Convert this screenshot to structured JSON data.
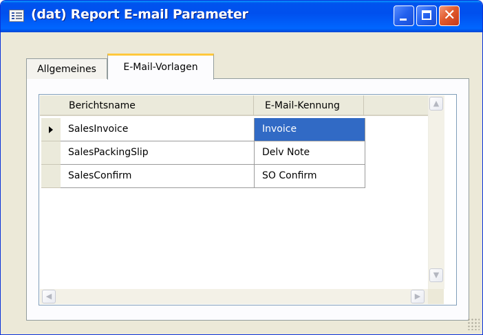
{
  "window": {
    "title": "(dat) Report E-mail Parameter"
  },
  "tabs": [
    {
      "label": "Allgemeines"
    },
    {
      "label": "E-Mail-Vorlagen"
    }
  ],
  "grid": {
    "columns": [
      "Berichtsname",
      "E-Mail-Kennung"
    ],
    "rows": [
      {
        "name": "SalesInvoice",
        "code": "Invoice"
      },
      {
        "name": "SalesPackingSlip",
        "code": "Delv Note"
      },
      {
        "name": "SalesConfirm",
        "code": "SO Confirm"
      }
    ]
  },
  "glyphs": {
    "close": "✕",
    "up": "▲",
    "down": "▼",
    "left": "◀",
    "right": "▶"
  },
  "colors": {
    "titlebar": "#0054e3",
    "active_tab_accent": "#ffc83c",
    "selection": "#316ac5"
  }
}
